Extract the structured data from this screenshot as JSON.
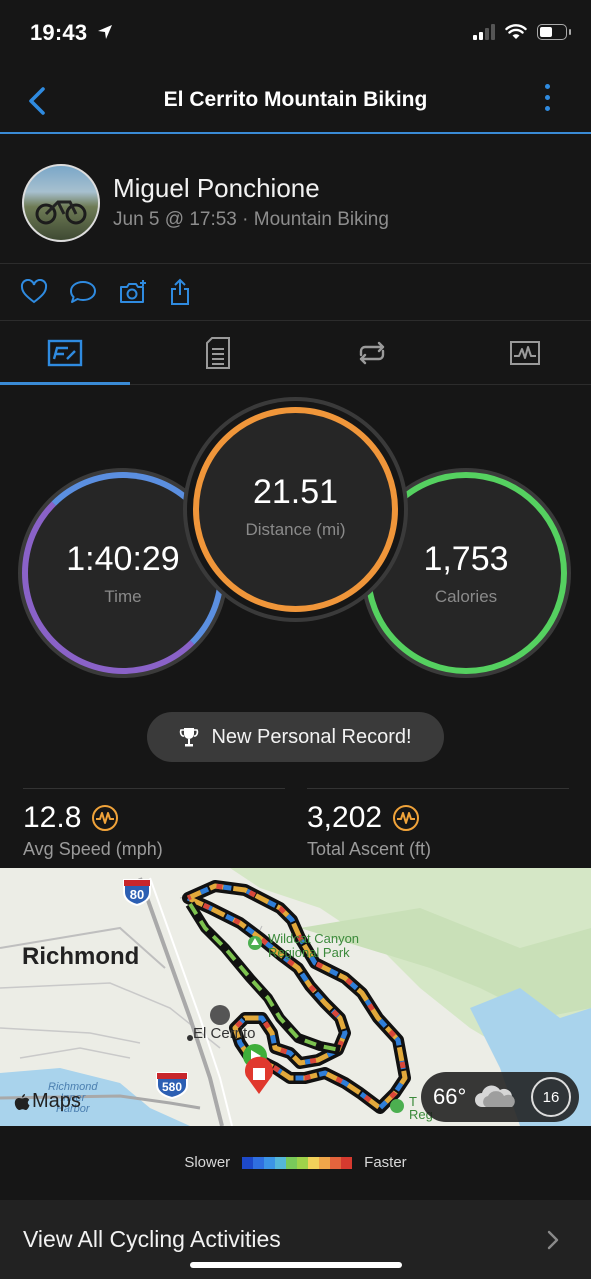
{
  "status_bar": {
    "time": "19:43"
  },
  "nav": {
    "title": "El Cerrito Mountain Biking"
  },
  "profile": {
    "name": "Miguel Ponchione",
    "meta": "Jun 5 @ 17:53 · Mountain Biking"
  },
  "rings": {
    "time": {
      "value": "1:40:29",
      "label": "Time",
      "color": "#6a8fd8"
    },
    "distance": {
      "value": "21.51",
      "label": "Distance (mi)",
      "color": "#f0963a"
    },
    "calories": {
      "value": "1,753",
      "label": "Calories",
      "color": "#55d160"
    }
  },
  "record": {
    "label": "New Personal Record!"
  },
  "stats": [
    {
      "value": "12.8",
      "label": "Avg Speed (mph)"
    },
    {
      "value": "3,202",
      "label": "Total Ascent (ft)"
    }
  ],
  "map": {
    "labels": {
      "richmond": "Richmond",
      "el_cerrito": "El Cerrito",
      "park_line1": "Wildcat Canyon",
      "park_line2": "Regional Park",
      "harbor_line1": "Richmond",
      "harbor_line2": "Inner",
      "harbor_line3": "Harbor",
      "hwy80": "80",
      "hwy580": "580",
      "maps_attribution": "Maps",
      "partial_t": "T",
      "partial_reg": "Reg"
    },
    "weather": {
      "temp": "66°",
      "aqi": "16"
    }
  },
  "legend": {
    "slower": "Slower",
    "faster": "Faster",
    "colors": [
      "#1d49c9",
      "#2f6fe0",
      "#3c94e6",
      "#55b7d9",
      "#79c95a",
      "#9fd24a",
      "#f2d15a",
      "#f0a64a",
      "#e4643d",
      "#d63a2f"
    ]
  },
  "footer": {
    "label": "View All Cycling Activities"
  }
}
